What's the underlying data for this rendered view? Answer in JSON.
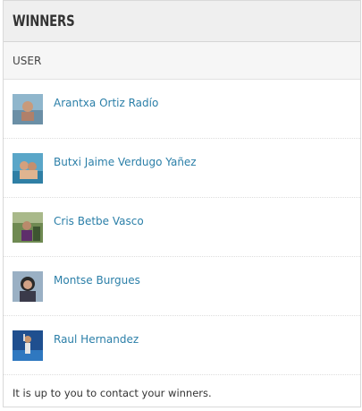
{
  "panel": {
    "title": "WINNERS",
    "column_header": "USER"
  },
  "winners": [
    {
      "name": "Arantxa Ortiz Radío",
      "avatar_icon": "avatar-photo"
    },
    {
      "name": "Butxi Jaime Verdugo Yañez",
      "avatar_icon": "avatar-photo"
    },
    {
      "name": "Cris Betbe Vasco",
      "avatar_icon": "avatar-photo"
    },
    {
      "name": "Montse Burgues",
      "avatar_icon": "avatar-photo"
    },
    {
      "name": "Raul Hernandez",
      "avatar_icon": "avatar-photo"
    }
  ],
  "footer": {
    "note": "It is up to you to contact your winners."
  },
  "colors": {
    "link": "#2b7fa8",
    "header_bg": "#efefef",
    "border": "#d9d9d9"
  }
}
